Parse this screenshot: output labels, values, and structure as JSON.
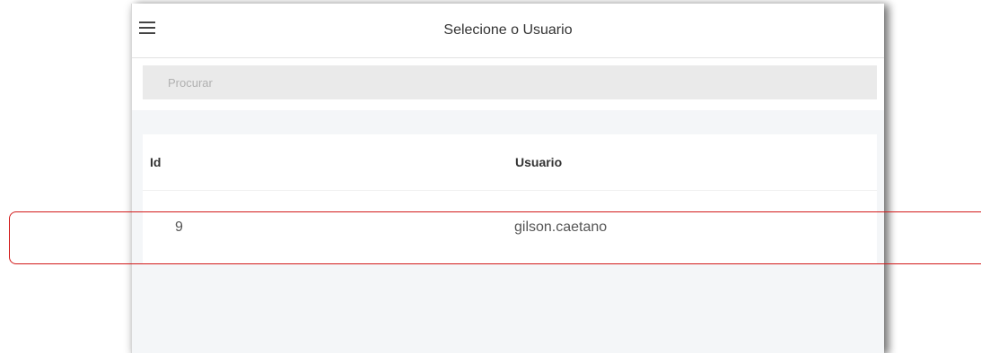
{
  "header": {
    "title": "Selecione o Usuario",
    "menu_icon": "hamburger-menu-icon"
  },
  "search": {
    "placeholder": "Procurar",
    "value": ""
  },
  "table": {
    "columns": [
      "Id",
      "Usuario"
    ],
    "rows": [
      {
        "id": "9",
        "usuario": "gilson.caetano"
      }
    ]
  },
  "colors": {
    "highlight": "#d21a1a",
    "search_background": "#eaeaea",
    "page_background": "#f4f6f8"
  }
}
